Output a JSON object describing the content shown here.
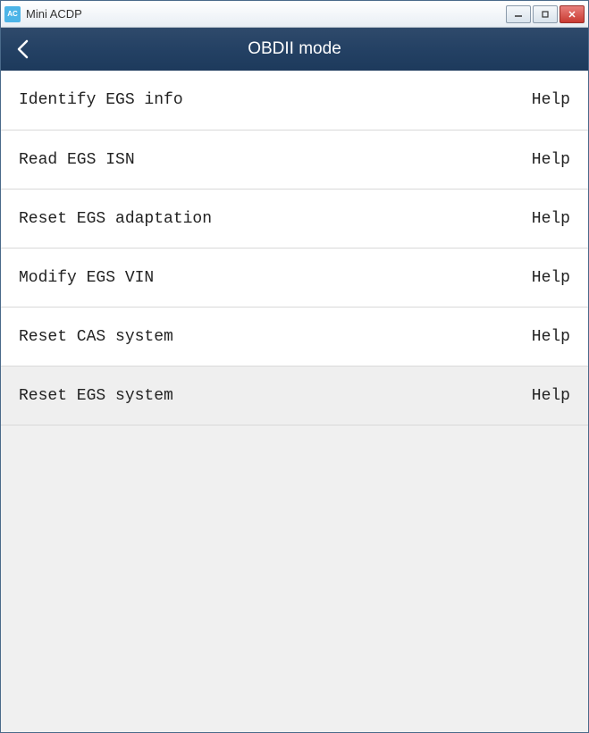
{
  "window": {
    "title": "Mini ACDP"
  },
  "header": {
    "title": "OBDII mode"
  },
  "help_label": "Help",
  "menu": [
    {
      "label": "Identify EGS info",
      "highlight": false
    },
    {
      "label": "Read EGS ISN",
      "highlight": false
    },
    {
      "label": "Reset EGS adaptation",
      "highlight": false
    },
    {
      "label": "Modify EGS VIN",
      "highlight": false
    },
    {
      "label": "Reset CAS system",
      "highlight": false
    },
    {
      "label": "Reset EGS system",
      "highlight": true
    }
  ]
}
